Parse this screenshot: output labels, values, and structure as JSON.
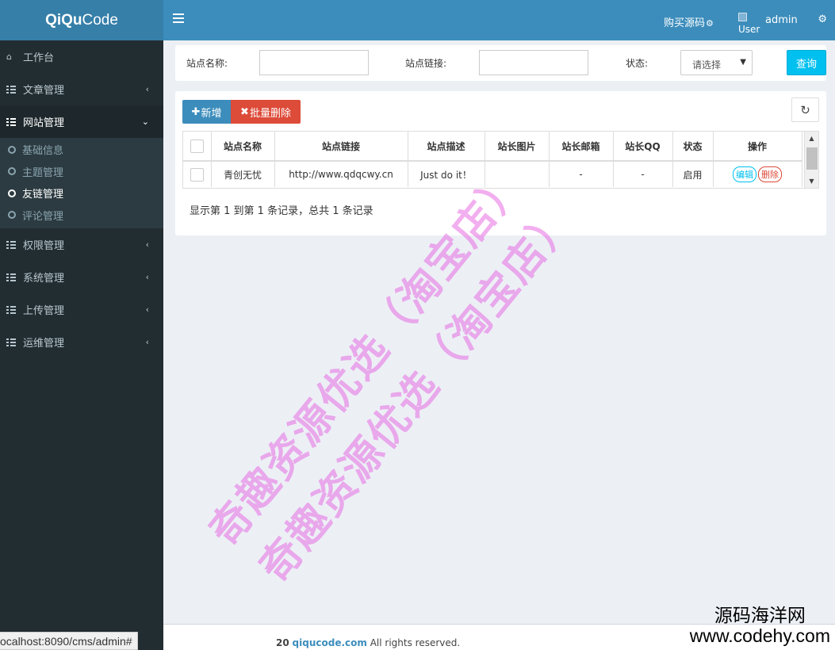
{
  "header": {
    "logo_bold": "QiQu",
    "logo_rest": "Code",
    "buy_source": "购买源码",
    "user_img_alt": "User",
    "username": "admin"
  },
  "sidebar": {
    "items": [
      {
        "label": "工作台"
      },
      {
        "label": "文章管理"
      },
      {
        "label": "网站管理"
      },
      {
        "label": "权限管理"
      },
      {
        "label": "系统管理"
      },
      {
        "label": "上传管理"
      },
      {
        "label": "运维管理"
      }
    ],
    "sub_items": [
      {
        "label": "基础信息"
      },
      {
        "label": "主题管理"
      },
      {
        "label": "友链管理"
      },
      {
        "label": "评论管理"
      }
    ]
  },
  "search": {
    "site_name_label": "站点名称:",
    "site_name_value": "",
    "site_url_label": "站点链接:",
    "site_url_value": "",
    "status_label": "状态:",
    "status_selected": "请选择",
    "query_button": "查询"
  },
  "toolbar": {
    "add_label": "新增",
    "batch_delete_label": "批量删除"
  },
  "table": {
    "columns": [
      "站点名称",
      "站点链接",
      "站点描述",
      "站长图片",
      "站长邮箱",
      "站长QQ",
      "状态",
      "操作"
    ],
    "rows": [
      {
        "site_name": "青创无忧",
        "site_url": "http://www.qdqcwy.cn",
        "description": "Just do it！",
        "owner_image": "",
        "owner_email": "-",
        "owner_qq": "-",
        "status": "启用",
        "edit": "编辑",
        "delete": "删除"
      }
    ]
  },
  "pagination": {
    "info": "显示第 1 到第 1 条记录，总共 1 条记录"
  },
  "footer": {
    "copyright_tail": "20",
    "link_text": "qiqucode.com",
    "rights": " All rights reserved."
  },
  "browser_status_url": "ocalhost:8090/cms/admin#",
  "watermark": {
    "line1": "奇趣资源优选（淘宝店）",
    "line2": "奇趣资源优选（淘宝店）"
  },
  "corner_watermark": {
    "cn": "源码海洋网",
    "url": "www.codehy.com"
  },
  "colors": {
    "header": "#3c8dbc",
    "logo_bg": "#367fa9",
    "sidebar": "#222d32",
    "primary": "#3c8dbc",
    "danger": "#dd4b39",
    "info": "#00c0ef"
  }
}
